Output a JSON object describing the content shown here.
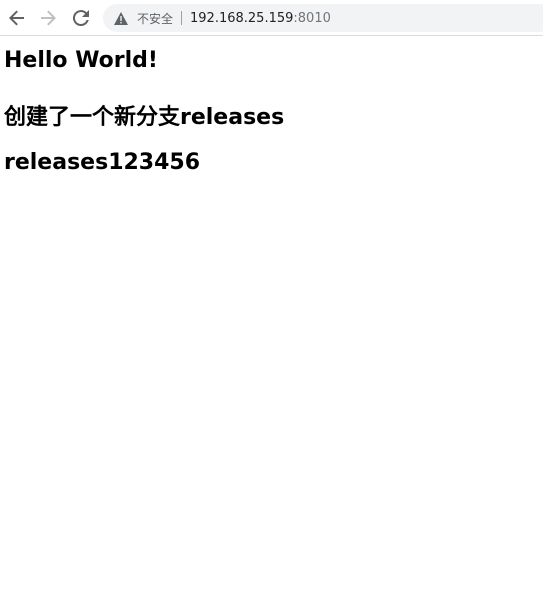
{
  "browser": {
    "security_label": "不安全",
    "url_host": "192.168.25.159",
    "url_port": ":8010",
    "icons": {
      "back": "arrow-left-icon",
      "forward": "arrow-right-icon",
      "reload": "reload-icon",
      "security": "warning-triangle-icon"
    }
  },
  "page": {
    "heading_1": "Hello World!",
    "heading_2": "创建了一个新分支releases",
    "heading_3": "releases123456"
  }
}
